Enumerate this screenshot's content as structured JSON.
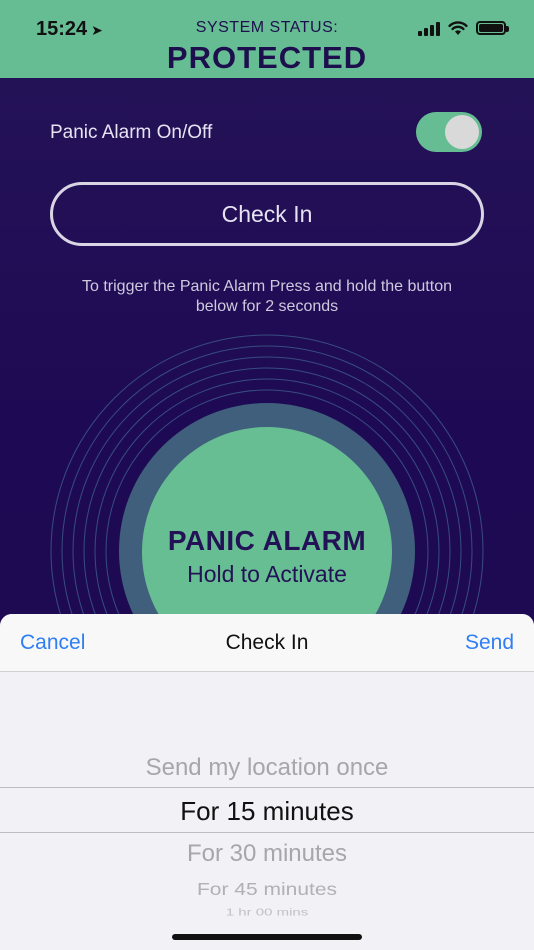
{
  "status_bar": {
    "time": "15:24",
    "location_glyph": "➤"
  },
  "system_status": {
    "label": "SYSTEM STATUS:",
    "value": "PROTECTED"
  },
  "panic_toggle": {
    "label": "Panic Alarm On/Off",
    "on": true
  },
  "check_in_button": {
    "label": "Check In"
  },
  "instructions": {
    "line1": "To trigger the Panic Alarm Press and hold the button",
    "line2": "below for 2 seconds"
  },
  "panic_button": {
    "title": "PANIC ALARM",
    "subtitle": "Hold to Activate"
  },
  "sheet": {
    "cancel_label": "Cancel",
    "title": "Check In",
    "send_label": "Send",
    "options": [
      "Send my location once",
      "For 15 minutes",
      "For 30 minutes",
      "For 45 minutes",
      "1 hr 00 mins"
    ],
    "selected_index": 1
  },
  "colors": {
    "accent_green": "#66bd93",
    "brand_navy": "#1d0f4d",
    "background_purple": "#1e0a54",
    "ios_blue": "#2f7ef4"
  }
}
